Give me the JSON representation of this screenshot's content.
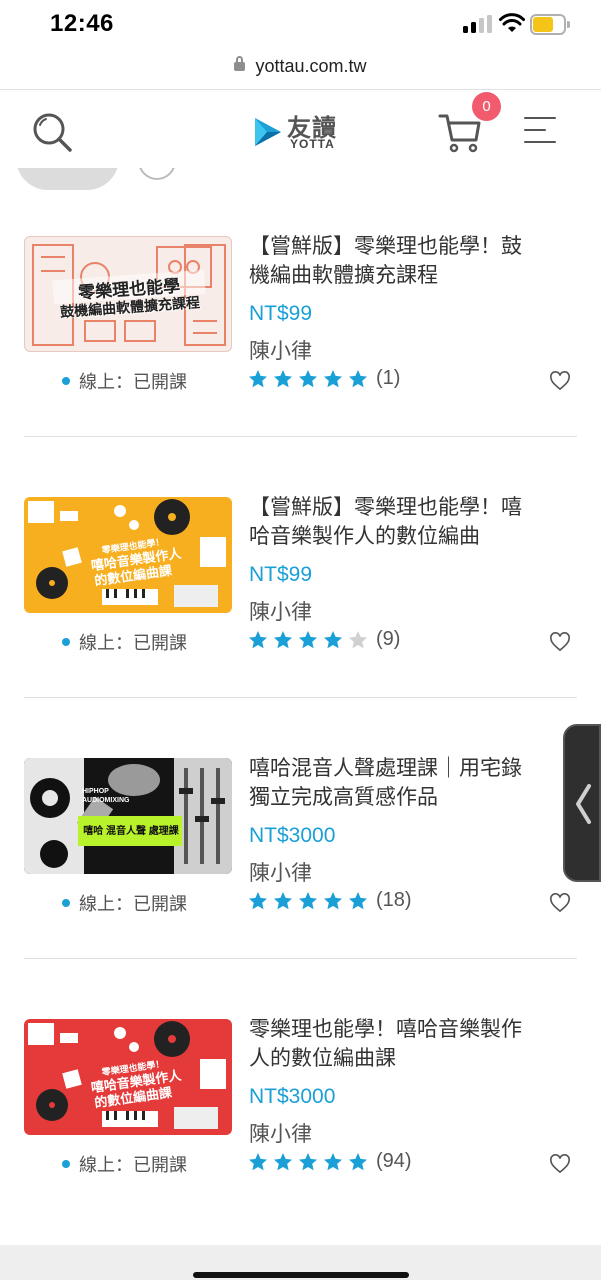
{
  "status_bar": {
    "time": "12:46",
    "battery_color": "#f5c419"
  },
  "browser": {
    "url": "yottau.com.tw"
  },
  "header": {
    "logo_zh": "友讀",
    "logo_en": "YOTTA",
    "cart_count": "0",
    "icons": [
      "search-icon",
      "cart-icon",
      "menu-icon"
    ]
  },
  "colors": {
    "accent": "#1a9fd6",
    "badge": "#f25a6e",
    "star_empty": "#d0d0d0"
  },
  "courses": [
    {
      "title": "【嘗鮮版】零樂理也能學！鼓機編曲軟體擴充課程",
      "price": "NT$99",
      "teacher": "陳小律",
      "status": "線上：已開課",
      "rating": 5,
      "reviews": "(1)",
      "thumb_text_1": "零樂理也能學",
      "thumb_text_2": "鼓機編曲軟體擴充課程"
    },
    {
      "title": "【嘗鮮版】零樂理也能學！嘻哈音樂製作人的數位編曲",
      "price": "NT$99",
      "teacher": "陳小律",
      "status": "線上：已開課",
      "rating": 4,
      "reviews": "(9)",
      "thumb_text_1": "零樂理也能學！",
      "thumb_text_2": "嘻哈音樂製作人",
      "thumb_text_3": "的數位編曲課"
    },
    {
      "title": "嘻哈混音人聲處理課｜用宅錄獨立完成高質感作品",
      "price": "NT$3000",
      "teacher": "陳小律",
      "status": "線上：已開課",
      "rating": 5,
      "reviews": "(18)",
      "thumb_text_1": "HIPHOP",
      "thumb_text_2": "AUDIOMIXING",
      "thumb_text_3": "嘻哈 混音人聲 處理課"
    },
    {
      "title": "零樂理也能學！嘻哈音樂製作人的數位編曲課",
      "price": "NT$3000",
      "teacher": "陳小律",
      "status": "線上：已開課",
      "rating": 5,
      "reviews": "(94)",
      "thumb_text_1": "零樂理也能學！",
      "thumb_text_2": "嘻哈音樂製作人",
      "thumb_text_3": "的數位編曲課"
    }
  ]
}
